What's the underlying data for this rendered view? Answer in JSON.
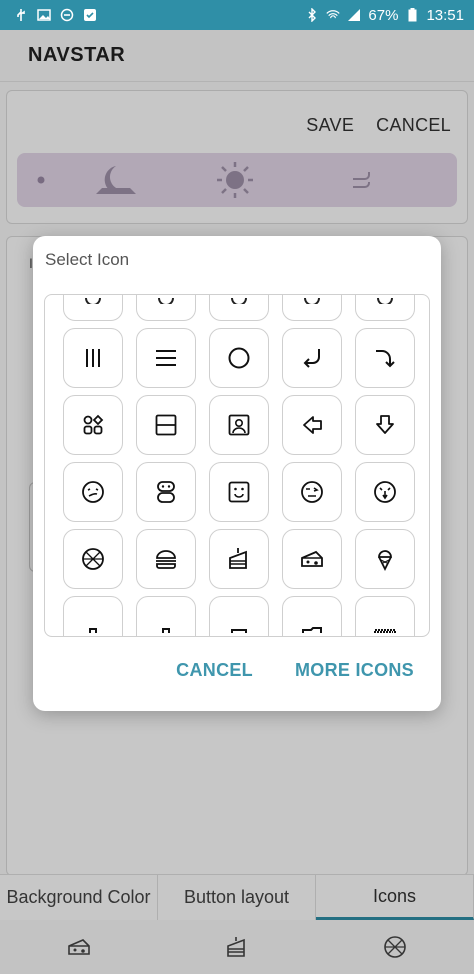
{
  "status_bar": {
    "icons_left": [
      "usb-icon",
      "image-icon",
      "do-not-disturb-icon",
      "check-box-icon"
    ],
    "icons_right": [
      "bluetooth-icon",
      "wifi-icon",
      "signal-icon"
    ],
    "battery": "67%",
    "time": "13:51"
  },
  "app": {
    "title": "NAVSTAR",
    "save_label": "SAVE",
    "cancel_label": "CANCEL",
    "preview_icons": [
      "dot-icon",
      "moon-icon",
      "sun-icon",
      "lines-icon"
    ],
    "card2_letter": "I"
  },
  "dialog": {
    "title": "Select Icon",
    "cancel_label": "CANCEL",
    "more_label": "MORE ICONS",
    "icons": [
      [
        "partial-icon",
        "partial-icon",
        "partial-icon",
        "partial-icon",
        "partial-icon"
      ],
      [
        "recents-bars-icon",
        "menu-lines-icon",
        "home-circle-icon",
        "return-arrow-icon",
        "curve-arrow-icon"
      ],
      [
        "apps-grid-icon",
        "split-square-icon",
        "portrait-icon",
        "back-arrow-icon",
        "down-arrow-icon"
      ],
      [
        "face-smirk-icon",
        "face-pill-icon",
        "face-square-icon",
        "face-wink-icon",
        "face-tongue-icon"
      ],
      [
        "pizza-icon",
        "burger-icon",
        "cake-icon",
        "cheese-icon",
        "ice-cream-icon"
      ],
      [
        "partial-icon",
        "partial-icon",
        "partial-icon",
        "partial-icon",
        "partial-icon"
      ]
    ]
  },
  "tabs": [
    {
      "label": "Background Color"
    },
    {
      "label": "Button layout"
    },
    {
      "label": "Icons",
      "active": true
    }
  ],
  "nav_bar": [
    "cheese-icon",
    "cake-icon",
    "pizza-icon"
  ],
  "colors": {
    "status_bar": "#2f8fa7",
    "accent": "#3f96ad",
    "nav_preview_bg": "#e4d8ea"
  }
}
